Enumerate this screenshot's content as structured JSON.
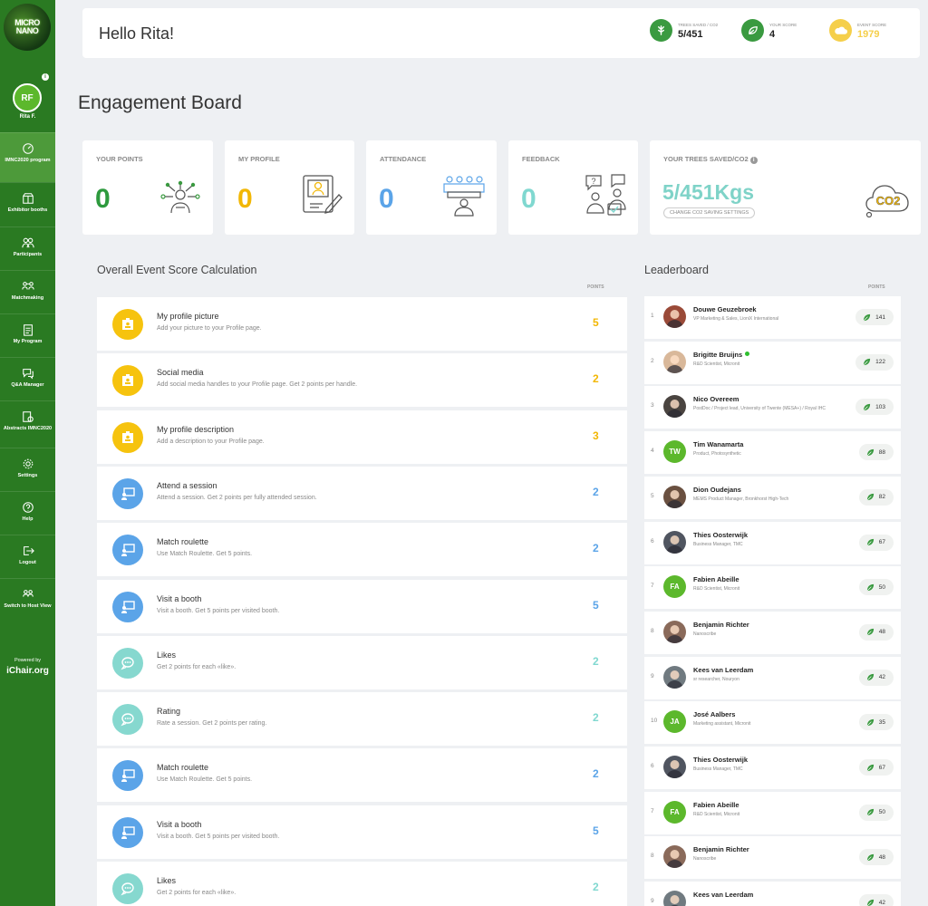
{
  "sidebar": {
    "logo_line1": "MICRO",
    "logo_line2": "NANO",
    "avatar_initials": "RF",
    "user_name": "Rita F.",
    "items": [
      {
        "label": "IMNC2020 program",
        "icon": "dashboard-icon",
        "active": true
      },
      {
        "label": "Exhibitor booths",
        "icon": "booth-icon",
        "active": false
      },
      {
        "label": "Participants",
        "icon": "participants-icon",
        "active": false
      },
      {
        "label": "Matchmaking",
        "icon": "matchmaking-icon",
        "active": false
      },
      {
        "label": "My Program",
        "icon": "clipboard-icon",
        "active": false
      },
      {
        "label": "Q&A Manager",
        "icon": "chat-icon",
        "active": false
      },
      {
        "label": "Abstracts IMNC2020",
        "icon": "abstracts-icon",
        "active": false
      },
      {
        "label": "Settings",
        "icon": "gear-icon",
        "active": false
      },
      {
        "label": "Help",
        "icon": "help-icon",
        "active": false
      },
      {
        "label": "Logout",
        "icon": "logout-icon",
        "active": false
      },
      {
        "label": "Switch to Host View",
        "icon": "switch-view-icon",
        "active": false
      }
    ],
    "powered_by": "Powered by",
    "powered_brand": "iChair.org"
  },
  "header": {
    "greeting": "Hello Rita!",
    "stats": [
      {
        "label": "TREES SAVED / CO2",
        "value": "5/451",
        "color": "#3a9a40",
        "icon": "tree-icon"
      },
      {
        "label": "YOUR SCORE",
        "value": "4",
        "color": "#3a9a40",
        "icon": "leaf-icon"
      },
      {
        "label": "EVENT SCORE",
        "value": "1979",
        "color": "#f5cf4a",
        "icon": "cloud-icon"
      }
    ]
  },
  "page_title": "Engagement Board",
  "cards": [
    {
      "title": "YOUR POINTS",
      "value": "0",
      "color": "#2e9a3e",
      "icon": "network-person-icon"
    },
    {
      "title": "MY PROFILE",
      "value": "0",
      "color": "#f2b705",
      "icon": "profile-document-icon"
    },
    {
      "title": "ATTENDANCE",
      "value": "0",
      "color": "#5ba4e8",
      "icon": "attendance-icon"
    },
    {
      "title": "FEEDBACK",
      "value": "0",
      "color": "#80d8d0",
      "icon": "feedback-icon"
    }
  ],
  "co2_card": {
    "title": "YOUR TREES SAVED/CO2",
    "value": "5/451Kgs",
    "button": "CHANGE CO2 SAVING SETTINGS",
    "badge": "CO2",
    "color": "#7fd3c8"
  },
  "score_section": {
    "title": "Overall Event Score Calculation",
    "points_header": "POINTS",
    "rows": [
      {
        "title": "My profile picture",
        "desc": "Add your picture to your Profile page.",
        "points": "5",
        "kind": "profile"
      },
      {
        "title": "Social media",
        "desc": "Add social media handles to your Profile page. Get 2 points per handle.",
        "points": "2",
        "kind": "profile"
      },
      {
        "title": "My profile description",
        "desc": "Add a description to your Profile page.",
        "points": "3",
        "kind": "profile"
      },
      {
        "title": "Attend a session",
        "desc": "Attend a session. Get 2 points per fully attended session.",
        "points": "2",
        "kind": "attend"
      },
      {
        "title": "Match roulette",
        "desc": "Use Match Roulette. Get 5 points.",
        "points": "2",
        "kind": "attend"
      },
      {
        "title": "Visit a booth",
        "desc": "Visit a booth. Get 5 points per visited booth.",
        "points": "5",
        "kind": "attend"
      },
      {
        "title": "Likes",
        "desc": "Get 2 points for each «like».",
        "points": "2",
        "kind": "feedback"
      },
      {
        "title": "Rating",
        "desc": "Rate a session. Get 2 points per rating.",
        "points": "2",
        "kind": "feedback"
      },
      {
        "title": "Match roulette",
        "desc": "Use Match Roulette. Get 5 points.",
        "points": "2",
        "kind": "attend"
      },
      {
        "title": "Visit a booth",
        "desc": "Visit a booth. Get 5 points per visited booth.",
        "points": "5",
        "kind": "attend"
      },
      {
        "title": "Likes",
        "desc": "Get 2 points for each «like».",
        "points": "2",
        "kind": "feedback"
      }
    ]
  },
  "leaderboard": {
    "title": "Leaderboard",
    "points_header": "POINTS",
    "rows": [
      {
        "rank": "1",
        "name": "Douwe Geuzebroek",
        "desc": "VP Marketing & Sales, LioniX International",
        "points": "141",
        "initials": "",
        "avatar_color": "#9a4a38",
        "online": false
      },
      {
        "rank": "2",
        "name": "Brigitte Bruijns",
        "desc": "R&D Scientist, Micronit",
        "points": "122",
        "initials": "",
        "avatar_color": "#d9b89a",
        "online": true
      },
      {
        "rank": "3",
        "name": "Nico Overeem",
        "desc": "PostDoc / Project lead, University of Twente (MESA+) / Royal IHC",
        "points": "103",
        "initials": "",
        "avatar_color": "#4a4440",
        "online": false
      },
      {
        "rank": "4",
        "name": "Tim Wanamarta",
        "desc": "Product, Photosynthetic",
        "points": "88",
        "initials": "TW",
        "avatar_color": "#5cb82c",
        "online": false
      },
      {
        "rank": "5",
        "name": "Dion Oudejans",
        "desc": "MEMS Product Manager, Bronkhorst High-Tech",
        "points": "82",
        "initials": "",
        "avatar_color": "#6a5040",
        "online": false
      },
      {
        "rank": "6",
        "name": "Thies Oosterwijk",
        "desc": "Business Manager, TMC",
        "points": "67",
        "initials": "",
        "avatar_color": "#505560",
        "online": false
      },
      {
        "rank": "7",
        "name": "Fabien Abeille",
        "desc": "R&D Scientist, Micronit",
        "points": "50",
        "initials": "FA",
        "avatar_color": "#5cb82c",
        "online": false
      },
      {
        "rank": "8",
        "name": "Benjamin Richter",
        "desc": "Nanoscribe",
        "points": "48",
        "initials": "",
        "avatar_color": "#8a6a5a",
        "online": false
      },
      {
        "rank": "9",
        "name": "Kees van Leerdam",
        "desc": "sr researcher, Nouryon",
        "points": "42",
        "initials": "",
        "avatar_color": "#707a80",
        "online": false
      },
      {
        "rank": "10",
        "name": "José Aalbers",
        "desc": "Marketing assistant, Micronit",
        "points": "35",
        "initials": "JA",
        "avatar_color": "#5cb82c",
        "online": false
      },
      {
        "rank": "6",
        "name": "Thies Oosterwijk",
        "desc": "Business Manager, TMC",
        "points": "67",
        "initials": "",
        "avatar_color": "#505560",
        "online": false
      },
      {
        "rank": "7",
        "name": "Fabien Abeille",
        "desc": "R&D Scientist, Micronit",
        "points": "50",
        "initials": "FA",
        "avatar_color": "#5cb82c",
        "online": false
      },
      {
        "rank": "8",
        "name": "Benjamin Richter",
        "desc": "Nanoscribe",
        "points": "48",
        "initials": "",
        "avatar_color": "#8a6a5a",
        "online": false
      },
      {
        "rank": "9",
        "name": "Kees van Leerdam",
        "desc": "",
        "points": "42",
        "initials": "",
        "avatar_color": "#707a80",
        "online": false
      }
    ]
  },
  "colors": {
    "sidebar_bg": "#2a7a22",
    "profile_yellow": "#f6c30e",
    "attend_blue": "#5ba4e8",
    "feedback_teal": "#86d8cf",
    "points_yellow": "#f2b705",
    "points_blue": "#5ba4e8",
    "points_teal": "#80d8d0",
    "leaf_green": "#3a9a40"
  }
}
